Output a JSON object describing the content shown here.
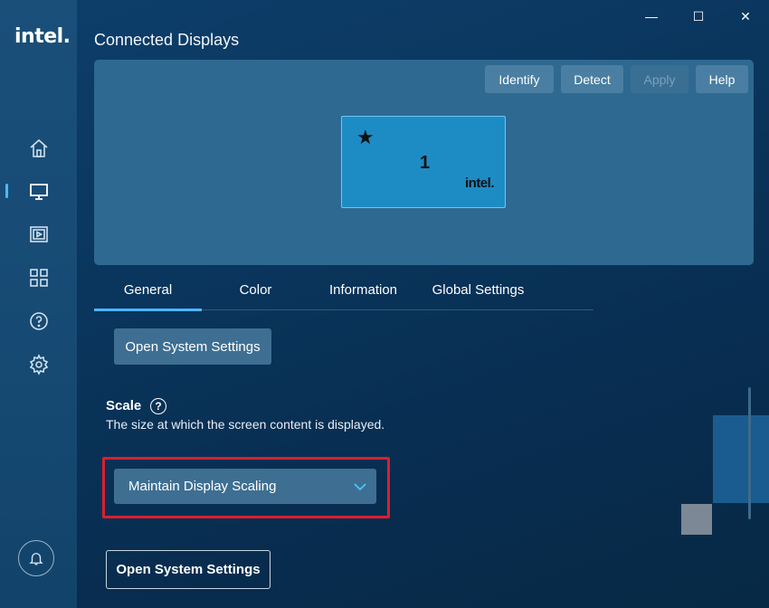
{
  "brand": {
    "logo_text": "intel."
  },
  "window": {
    "minimize": "—",
    "maximize": "☐",
    "close": "✕"
  },
  "page": {
    "title": "Connected Displays"
  },
  "toolbar": {
    "identify": "Identify",
    "detect": "Detect",
    "apply": "Apply",
    "help": "Help"
  },
  "monitor": {
    "star": "★",
    "number": "1",
    "logo": "intel."
  },
  "tabs": [
    {
      "label": "General"
    },
    {
      "label": "Color"
    },
    {
      "label": "Information"
    },
    {
      "label": "Global Settings"
    }
  ],
  "general": {
    "open_system_settings_top": "Open System Settings",
    "scale_label": "Scale",
    "scale_help": "?",
    "scale_description": "The size at which the screen content is displayed.",
    "scale_value": "Maintain Display Scaling",
    "open_system_settings_bottom": "Open System Settings"
  },
  "nav": {
    "icons": [
      "home-icon",
      "display-icon",
      "video-icon",
      "apps-icon",
      "help-icon",
      "settings-icon"
    ]
  },
  "colors": {
    "accent": "#4fb6ff",
    "highlight": "#d9202f"
  }
}
